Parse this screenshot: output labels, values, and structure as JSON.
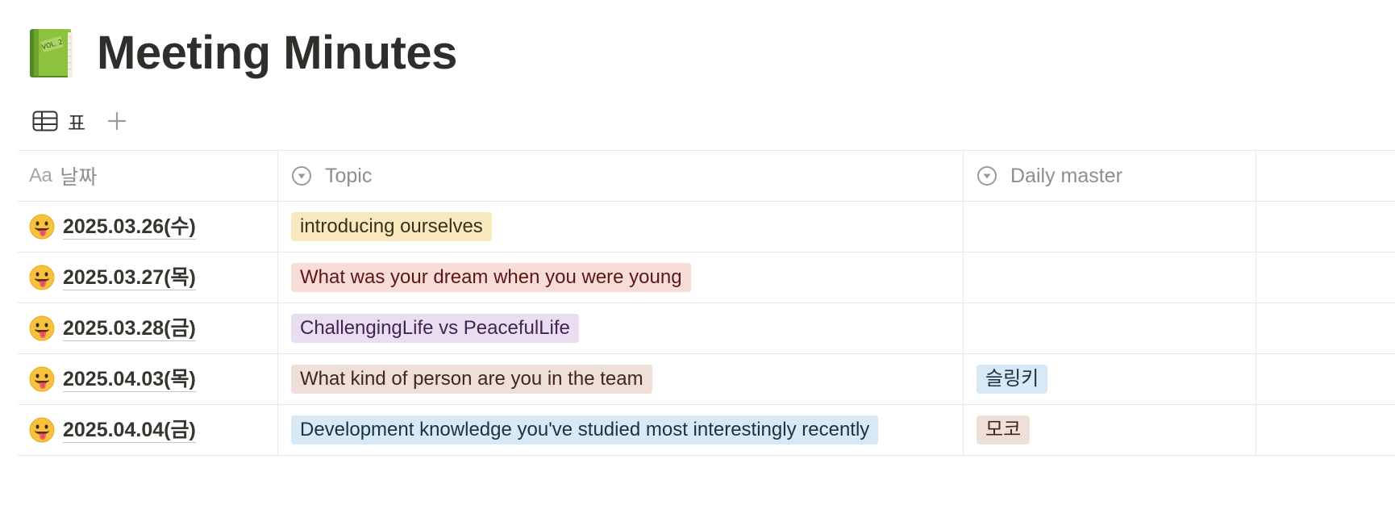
{
  "page": {
    "title": "Meeting Minutes",
    "icon": "green-book-icon"
  },
  "view_tabs": [
    {
      "label": "표",
      "icon": "table-icon"
    }
  ],
  "add_view_icon": "plus-icon",
  "table": {
    "columns": [
      {
        "label": "날짜",
        "icon_text": "Aa",
        "icon": "title-property-icon"
      },
      {
        "label": "Topic",
        "icon": "select-property-icon"
      },
      {
        "label": "Daily master",
        "icon": "select-property-icon"
      }
    ],
    "rows": [
      {
        "emoji": "tongue-out-face-icon",
        "date": "2025.03.26(수)",
        "topic": "introducing ourselves",
        "topic_color": "#f9e9bf",
        "master": ""
      },
      {
        "emoji": "tongue-out-face-icon",
        "date": "2025.03.27(목)",
        "topic": "What was your dream when you were young",
        "topic_color": "#f8dcd8",
        "master": ""
      },
      {
        "emoji": "tongue-out-face-icon",
        "date": "2025.03.28(금)",
        "topic": "ChallengingLife vs PeacefulLife",
        "topic_color": "#e9def0",
        "master": ""
      },
      {
        "emoji": "tongue-out-face-icon",
        "date": "2025.04.03(목)",
        "topic": "What kind of person are you in the team",
        "topic_color": "#eee0d9",
        "master": "슬링키",
        "master_color": "#d8e8f4"
      },
      {
        "emoji": "tongue-out-face-icon",
        "date": "2025.04.04(금)",
        "topic": "Development knowledge you've studied most interestingly recently",
        "topic_color": "#d8e8f4",
        "master": "모코",
        "master_color": "#eee0d9"
      }
    ]
  }
}
